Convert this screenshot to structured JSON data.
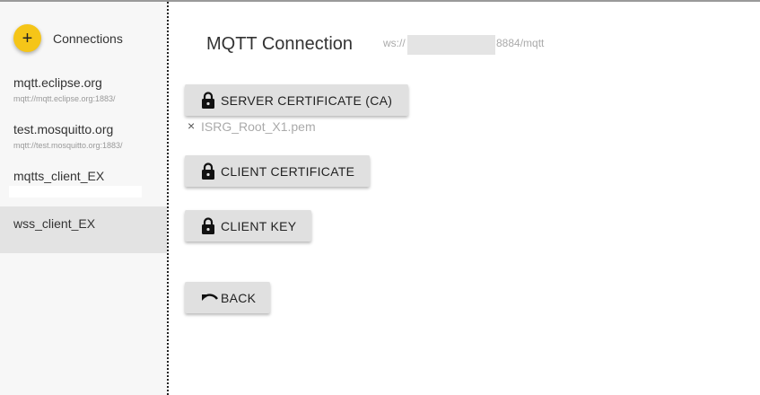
{
  "sidebar": {
    "add_button": "+",
    "title": "Connections",
    "connections": [
      {
        "name": "mqtt.eclipse.org",
        "url": "mqtt://mqtt.eclipse.org:1883/"
      },
      {
        "name": "test.mosquitto.org",
        "url": "mqtt://test.mosquitto.org:1883/"
      },
      {
        "name": "mqtts_client_EX",
        "url": ""
      },
      {
        "name": "wss_client_EX",
        "url": ""
      }
    ],
    "active_index": 3
  },
  "main": {
    "title": "MQTT Connection",
    "ws_prefix": "ws://",
    "ws_suffix": "8884/mqtt",
    "buttons": {
      "server_cert": "SERVER CERTIFICATE (CA)",
      "client_cert": "CLIENT CERTIFICATE",
      "client_key": "CLIENT KEY",
      "back": "BACK"
    },
    "server_cert_file": {
      "remove": "×",
      "name": "ISRG_Root_X1.pem"
    }
  },
  "colors": {
    "fab": "#f5c518",
    "button_bg": "#e0e0e0",
    "active_item": "#e3e3e3",
    "sidebar_bg": "#f7f7f7"
  },
  "icons": {
    "lock": "lock-icon",
    "back": "undo-icon",
    "remove": "close-icon",
    "add": "plus-icon"
  }
}
